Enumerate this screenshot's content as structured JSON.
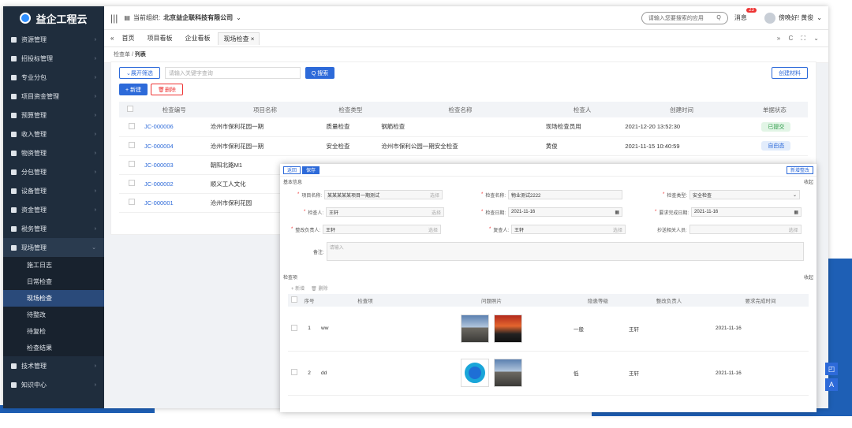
{
  "app": {
    "logo_text": "益企工程云",
    "org_label": "当前组织:",
    "org_name": "北京益企联科技有限公司",
    "search_app_placeholder": "请输入您要搜索的应用",
    "message_label": "消息",
    "message_count": "23",
    "user_greeting": "傍晚好! 黄俊"
  },
  "sidebar": {
    "items": [
      {
        "label": "资源管理"
      },
      {
        "label": "招投标管理"
      },
      {
        "label": "专业分包"
      },
      {
        "label": "项目资金管理"
      },
      {
        "label": "预算管理"
      },
      {
        "label": "收入管理"
      },
      {
        "label": "物资管理"
      },
      {
        "label": "分包管理"
      },
      {
        "label": "设备管理"
      },
      {
        "label": "资金管理"
      },
      {
        "label": "税务管理"
      },
      {
        "label": "现场管理"
      }
    ],
    "sub_items": [
      {
        "label": "施工日志"
      },
      {
        "label": "日常检查"
      },
      {
        "label": "现场检查"
      },
      {
        "label": "待整改"
      },
      {
        "label": "待复检"
      },
      {
        "label": "检查结果"
      }
    ],
    "bottom_items": [
      {
        "label": "技术管理"
      },
      {
        "label": "知识中心"
      }
    ]
  },
  "tabs": [
    {
      "label": "首页"
    },
    {
      "label": "项目看板"
    },
    {
      "label": "企业看板"
    },
    {
      "label": "现场检查"
    }
  ],
  "breadcrumb": {
    "parent": "检查单",
    "current": "列表"
  },
  "toolbar": {
    "expand_filter": "展开筛选",
    "search_placeholder": "请输入关键字查询",
    "search_button": "Q 搜索",
    "add_button": "+ 新建",
    "delete_button": "删除",
    "create_template": "创建材料"
  },
  "table": {
    "headers": [
      "检查编号",
      "项目名称",
      "检查类型",
      "检查名称",
      "检查人",
      "创建时间",
      "单据状态"
    ],
    "rows": [
      {
        "code": "JC-000006",
        "project": "沧州市保利花园一期",
        "type": "质量检查",
        "name": "钢筋检查",
        "inspector": "现场检查员用",
        "time": "2021-12-20 13:52:30",
        "status": "已提交"
      },
      {
        "code": "JC-000004",
        "project": "沧州市保利花园一期",
        "type": "安全检查",
        "name": "沧州市保利公园一期安全检查",
        "inspector": "黄俊",
        "time": "2021-11-15 10:40:59",
        "status": "自由态"
      },
      {
        "code": "JC-000003",
        "project": "朝阳北路M1",
        "type": "",
        "name": "",
        "inspector": "",
        "time": "",
        "status": ""
      },
      {
        "code": "JC-000002",
        "project": "顺义工人文化",
        "type": "",
        "name": "",
        "inspector": "",
        "time": "",
        "status": ""
      },
      {
        "code": "JC-000001",
        "project": "沧州市保利花园",
        "type": "",
        "name": "",
        "inspector": "",
        "time": "",
        "status": ""
      }
    ]
  },
  "panel": {
    "btn_back": "返回",
    "btn_edit": "保存",
    "btn_save": "新增整改",
    "section_basic": "基本信息",
    "section_basic_right": "收起",
    "fields": {
      "project_label": "项目名称:",
      "project_value": "某某某某某项目一期测试",
      "project_hint": "选择",
      "check_name_label": "检查名称:",
      "check_name_value": "物业测试2222",
      "check_type_label": "检查类型:",
      "check_type_value": "安全检查",
      "inspector_label": "检查人:",
      "inspector_value": "王轩",
      "inspector_hint": "选择",
      "check_date_label": "检查日期:",
      "check_date_value": "2021-11-16",
      "deadline_label": "要求完成日期:",
      "deadline_value": "2021-11-16",
      "rectifier_label": "整改负责人:",
      "rectifier_value": "王轩",
      "rectifier_hint": "选择",
      "recheck_label": "复查人:",
      "recheck_value": "王轩",
      "recheck_hint": "选择",
      "cc_label": "抄送相关人员:",
      "cc_hint": "选择",
      "remark_label": "备注:",
      "remark_hint": "请输入"
    },
    "section_items": "检查项",
    "section_items_right": "收起",
    "item_add": "+ 新增",
    "item_delete": "删除",
    "item_headers": [
      "",
      "序号",
      "检查项",
      "问题照片",
      "隐患等级",
      "整改负责人",
      "要求完成时间"
    ],
    "item_rows": [
      {
        "index": "1",
        "item": "ww",
        "level": "一般",
        "owner": "王轩",
        "deadline": "2021-11-16"
      },
      {
        "index": "2",
        "item": "dd",
        "level": "低",
        "owner": "王轩",
        "deadline": "2021-11-16"
      }
    ]
  }
}
